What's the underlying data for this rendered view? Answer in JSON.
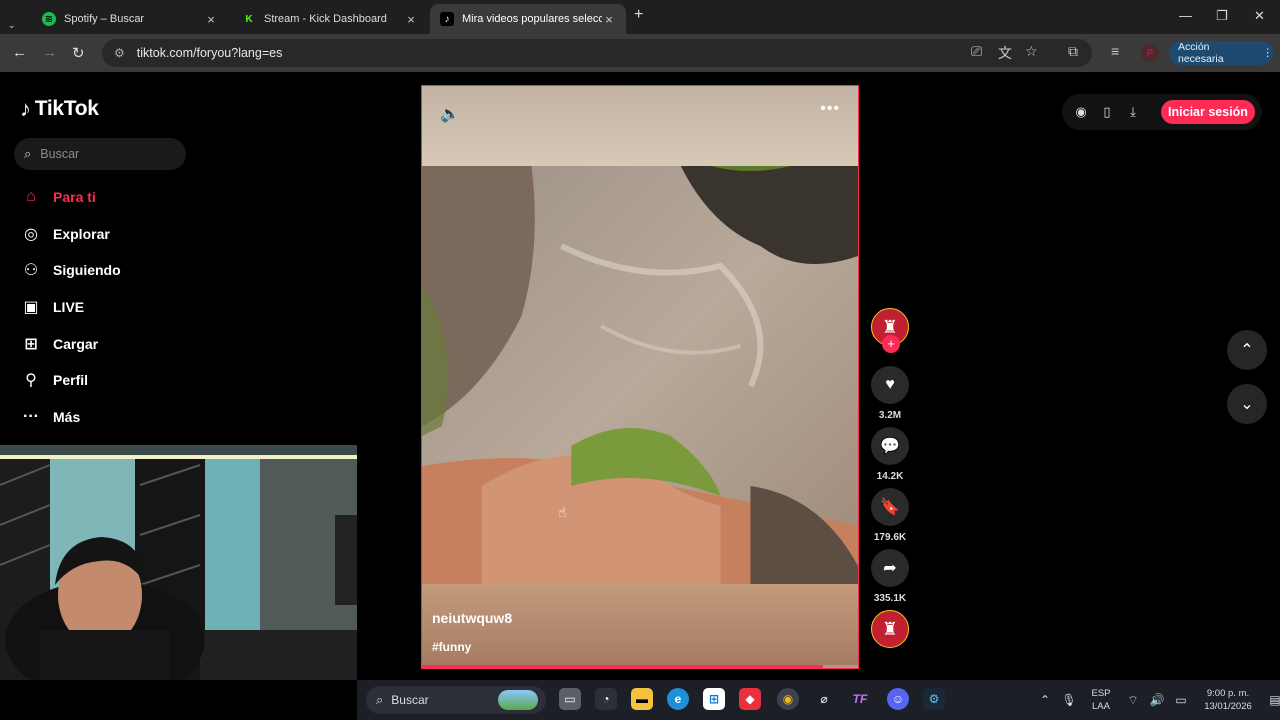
{
  "browser": {
    "tabs": [
      {
        "title": "Spotify – Buscar",
        "favicon": "spotify-icon",
        "active": false
      },
      {
        "title": "Stream - Kick Dashboard",
        "favicon": "kick-icon",
        "active": false
      },
      {
        "title": "Mira videos populares seleccionados",
        "favicon": "tiktok-icon",
        "active": true
      }
    ],
    "url": "tiktok.com/foryou?lang=es",
    "action_button": "Acción necesaria",
    "profile_initial": "P"
  },
  "tiktok": {
    "logo": "TikTok",
    "search_placeholder": "Buscar",
    "nav": [
      {
        "label": "Para ti",
        "icon": "home-icon",
        "active": true
      },
      {
        "label": "Explorar",
        "icon": "compass-icon",
        "active": false
      },
      {
        "label": "Siguiendo",
        "icon": "following-icon",
        "active": false
      },
      {
        "label": "LIVE",
        "icon": "live-icon",
        "active": false
      },
      {
        "label": "Cargar",
        "icon": "upload-icon",
        "active": false
      },
      {
        "label": "Perfil",
        "icon": "profile-icon",
        "active": false
      },
      {
        "label": "Más",
        "icon": "more-icon",
        "active": false
      }
    ],
    "login_button": "Iniciar sesión",
    "video": {
      "author": "neiutwquw8",
      "hashtag": "#funny",
      "progress": 0.92
    },
    "actions": {
      "likes": "3.2M",
      "comments": "14.2K",
      "saves": "179.6K",
      "shares": "335.1K"
    }
  },
  "taskbar": {
    "search_placeholder": "Buscar",
    "lang_line1": "ESP",
    "lang_line2": "LAA",
    "time": "9:00 p. m.",
    "date": "13/01/2026"
  },
  "colors": {
    "accent": "#fe2c55",
    "background": "#000000"
  }
}
